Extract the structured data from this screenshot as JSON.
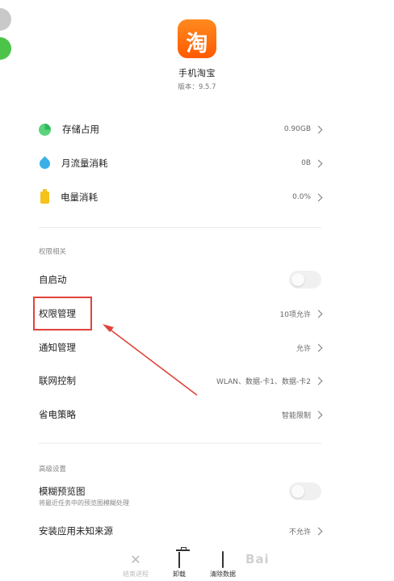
{
  "app": {
    "icon_char": "淘",
    "name": "手机淘宝",
    "version": "版本：9.5.7"
  },
  "usage_items": [
    {
      "label": "存储占用",
      "value": "0.90GB",
      "icon": "storage-pie-icon"
    },
    {
      "label": "月流量消耗",
      "value": "0B",
      "icon": "data-drop-icon"
    },
    {
      "label": "电量消耗",
      "value": "0.0%",
      "icon": "battery-icon"
    }
  ],
  "permissions_section": {
    "title": "权限相关",
    "autostart": {
      "label": "自启动",
      "enabled": false
    },
    "permission_management": {
      "label": "权限管理",
      "value": "10项允许"
    },
    "notification_management": {
      "label": "通知管理",
      "value": "允许"
    },
    "network_control": {
      "label": "联网控制",
      "value": "WLAN、数据-卡1、数据-卡2"
    },
    "power_saving": {
      "label": "省电策略",
      "value": "智能限制"
    }
  },
  "advanced_section": {
    "title": "高级设置",
    "blur_preview": {
      "label": "模糊预览图",
      "description": "将最近任务中的预览图模糊处理",
      "enabled": false
    },
    "unknown_sources": {
      "label": "安装应用未知来源",
      "value": "不允许"
    }
  },
  "bottom_bar": {
    "end_process": "结束进程",
    "uninstall": "卸载",
    "clear_data": "清除数据"
  },
  "watermark": "Bai"
}
